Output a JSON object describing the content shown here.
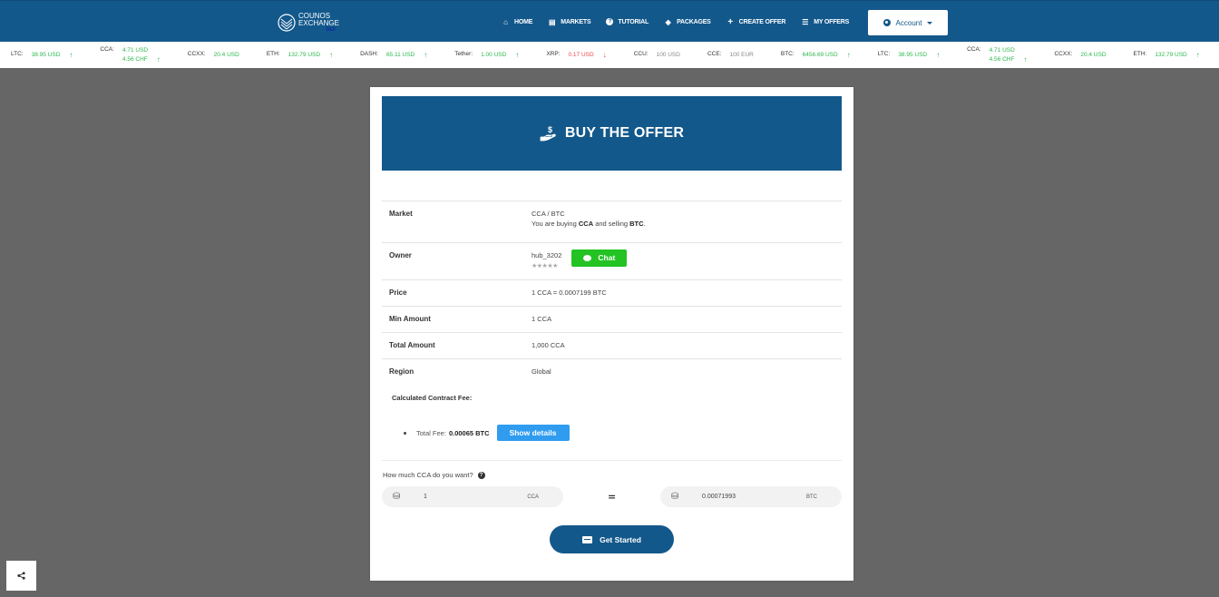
{
  "header": {
    "logo": {
      "line1": "COUNOS",
      "line2": "EXCHANGE",
      "line3": "DEX"
    },
    "nav": [
      {
        "icon": "home-icon",
        "glyph": "⌂",
        "label": "HOME"
      },
      {
        "icon": "markets-icon",
        "glyph": "▤",
        "label": "MARKETS"
      },
      {
        "icon": "question-circle-icon",
        "glyph": "?",
        "label": "TUTORIAL"
      },
      {
        "icon": "cube-icon",
        "glyph": "◈",
        "label": "PACKAGES"
      },
      {
        "icon": "plus-icon",
        "glyph": "+",
        "label": "CREATE OFFER"
      },
      {
        "icon": "list-icon",
        "glyph": "☰",
        "label": "MY OFFERS"
      }
    ],
    "account_label": "Account"
  },
  "ticker": [
    {
      "symbol": "LTC:",
      "values": [
        {
          "text": "38.95 USD",
          "trend": "up"
        }
      ]
    },
    {
      "symbol": "CCA:",
      "values": [
        {
          "text": "4.71 USD",
          "trend": ""
        },
        {
          "text": "4.56 CHF",
          "trend": "up"
        }
      ]
    },
    {
      "symbol": "CCXX:",
      "values": [
        {
          "text": "20.4 USD",
          "trend": ""
        }
      ]
    },
    {
      "symbol": "ETH:",
      "values": [
        {
          "text": "132.79 USD",
          "trend": "up"
        }
      ]
    },
    {
      "symbol": "DASH:",
      "values": [
        {
          "text": "65.11 USD",
          "trend": "up"
        }
      ]
    },
    {
      "symbol": "Tether:",
      "values": [
        {
          "text": "1.00 USD",
          "trend": "up"
        }
      ]
    },
    {
      "symbol": "XRP:",
      "values": [
        {
          "text": "0.17 USD",
          "trend": "down"
        }
      ]
    },
    {
      "symbol": "CCU:",
      "values": [
        {
          "text": "100 USD",
          "trend": "flat"
        }
      ]
    },
    {
      "symbol": "CCE:",
      "values": [
        {
          "text": "100 EUR",
          "trend": "flat"
        }
      ]
    },
    {
      "symbol": "BTC:",
      "values": [
        {
          "text": "6456.69 USD",
          "trend": "up"
        }
      ]
    },
    {
      "symbol": "LTC:",
      "values": [
        {
          "text": "38.95 USD",
          "trend": "up"
        }
      ]
    },
    {
      "symbol": "CCA:",
      "values": [
        {
          "text": "4.71 USD",
          "trend": ""
        },
        {
          "text": "4.56 CHF",
          "trend": "up"
        }
      ]
    },
    {
      "symbol": "CCXX:",
      "values": [
        {
          "text": "20.4 USD",
          "trend": ""
        }
      ]
    },
    {
      "symbol": "ETH:",
      "values": [
        {
          "text": "132.79 USD",
          "trend": "up"
        }
      ]
    }
  ],
  "offer": {
    "title": "BUY THE OFFER",
    "rows": {
      "market": {
        "label": "Market",
        "pair": "CCA / BTC",
        "desc_prefix": "You are buying ",
        "buy": "CCA",
        "desc_mid": " and selling ",
        "sell": "BTC",
        "desc_suffix": "."
      },
      "owner": {
        "label": "Owner",
        "name": "hub_3202",
        "stars": "★★★★★",
        "chat_label": "Chat"
      },
      "price": {
        "label": "Price",
        "value": "1 CCA = 0.0007199 BTC"
      },
      "min_amount": {
        "label": "Min Amount",
        "value": "1 CCA"
      },
      "total_amount": {
        "label": "Total Amount",
        "value": "1,000 CCA"
      },
      "region": {
        "label": "Region",
        "value": "Global"
      }
    },
    "fee": {
      "title": "Calculated Contract Fee:",
      "label": "Total Fee:",
      "value": "0.00065 BTC",
      "details_button": "Show details"
    },
    "quantity": {
      "question": "How much CCA do you want?",
      "buy_amount": "1",
      "buy_currency": "CCA",
      "equals": "=",
      "pay_amount": "0.00071993",
      "pay_currency": "BTC"
    },
    "cta_label": "Get Started"
  },
  "colors": {
    "primary": "#13588b",
    "up": "#2db84d",
    "down": "#e8474d",
    "chat": "#22c322",
    "details": "#2f9cf0",
    "background": "#666666"
  }
}
